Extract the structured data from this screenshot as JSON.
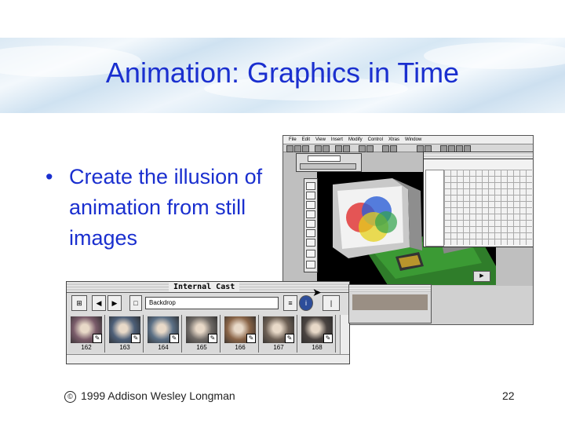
{
  "slide": {
    "title": "Animation: Graphics in Time",
    "bullet_marker": "•",
    "bullet_text": "Create the illusion of animation from still images",
    "copyright_symbol": "©",
    "footer": "1999 Addison Wesley Longman",
    "page_number": "22"
  },
  "screenshot": {
    "menu_items": [
      "File",
      "Edit",
      "View",
      "Insert",
      "Modify",
      "Control",
      "Xtras",
      "Window"
    ],
    "play_button": "▶",
    "cast_window": {
      "title": "Internal Cast",
      "member_name": "Backdrop",
      "nav_prev": "◀",
      "nav_next": "▶",
      "info_button": "i",
      "thumbnails": [
        {
          "number": "162",
          "color": "#7a5c6a"
        },
        {
          "number": "163",
          "color": "#4d5f78"
        },
        {
          "number": "164",
          "color": "#5b6f85"
        },
        {
          "number": "165",
          "color": "#6f6a66"
        },
        {
          "number": "166",
          "color": "#8a6548"
        },
        {
          "number": "167",
          "color": "#6d6055"
        },
        {
          "number": "168",
          "color": "#4a4340"
        }
      ]
    }
  }
}
